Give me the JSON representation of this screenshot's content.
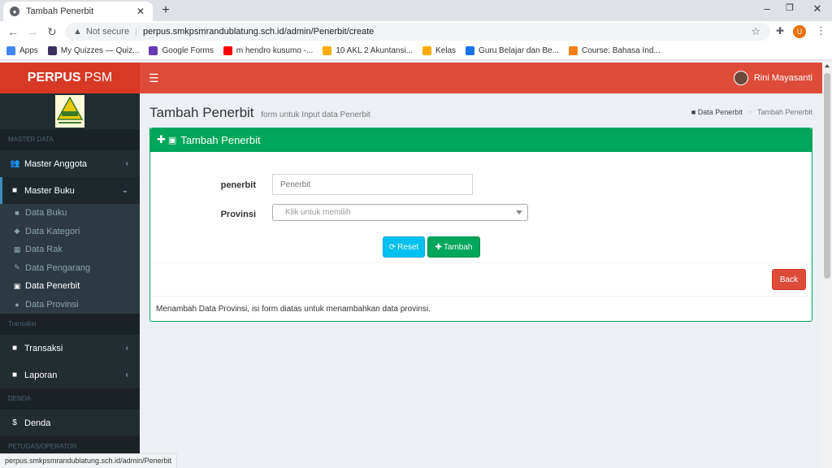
{
  "browser": {
    "tab_title": "Tambah Penerbit",
    "tab_close": "✕",
    "new_tab": "+",
    "window_controls": {
      "minimize": "–",
      "restore": "❐",
      "close": "✕"
    },
    "nav": {
      "back": "←",
      "forward": "→",
      "reload": "↻"
    },
    "not_secure": "Not secure",
    "url": "perpus.smkpsmrandublatung.sch.id/admin/Penerbit/create",
    "bookmarks": [
      {
        "label": "Apps",
        "icon": "apps-grid-icon",
        "color": "#4285f4"
      },
      {
        "label": "My Quizzes — Quiz...",
        "icon": "quizizz-icon",
        "color": "#3b2f5c"
      },
      {
        "label": "Google Forms",
        "icon": "google-forms-icon",
        "color": "#673ab7"
      },
      {
        "label": "m hendro kusumo -...",
        "icon": "youtube-icon",
        "color": "#ff0000"
      },
      {
        "label": "10 AKL 2 Akuntansi...",
        "icon": "classroom-icon",
        "color": "#f9ab00"
      },
      {
        "label": "Kelas",
        "icon": "classroom-icon",
        "color": "#f9ab00"
      },
      {
        "label": "Guru Belajar dan Be...",
        "icon": "guru-belajar-icon",
        "color": "#1a73e8"
      },
      {
        "label": "Course: Bahasa Ind...",
        "icon": "moodle-icon",
        "color": "#f98012"
      }
    ],
    "profile_initial": "U",
    "status_url": "perpus.smkpsmrandublatung.sch.id/admin/Penerbit"
  },
  "app": {
    "brand_bold": "PERPUS",
    "brand_rest": "PSM",
    "user_name": "Rini Mayasanti",
    "sidebar": {
      "header_master": "MASTER DATA",
      "master_anggota": "Master Anggota",
      "master_buku": "Master Buku",
      "sub_items": [
        {
          "label": "Data Buku",
          "icon": "book-icon"
        },
        {
          "label": "Data Kategori",
          "icon": "tags-icon"
        },
        {
          "label": "Data Rak",
          "icon": "table-icon"
        },
        {
          "label": "Data Pengarang",
          "icon": "edit-icon"
        },
        {
          "label": "Data Penerbit",
          "icon": "building-icon"
        },
        {
          "label": "Data Provinsi",
          "icon": "globe-icon"
        }
      ],
      "header_transaksi": "Transaksi",
      "transaksi": "Transaksi",
      "laporan": "Laporan",
      "header_denda": "DENDA",
      "denda": "Denda",
      "header_petugas": "PETUGAS/OPERATOR"
    },
    "page": {
      "title": "Tambah Penerbit",
      "subtitle": "form untuk Input data Penerbit",
      "breadcrumb": [
        "Data Penerbit",
        "Tambah Penerbit"
      ]
    },
    "form": {
      "box_title": "Tambah Penerbit",
      "penerbit_label": "penerbit",
      "penerbit_placeholder": "Penerbit",
      "provinsi_label": "Provinsi",
      "provinsi_placeholder": "Klik untuk memilih",
      "reset_label": "Reset",
      "tambah_label": "Tambah",
      "back_label": "Back",
      "note": "Menambah Data Provinsi, isi form diatas untuk menambahkan data provinsi."
    }
  },
  "colors": {
    "navbar": "#dd4b39",
    "sidebar": "#222d32",
    "success": "#00a65a",
    "info": "#00c0ef",
    "danger": "#dd4b39"
  }
}
